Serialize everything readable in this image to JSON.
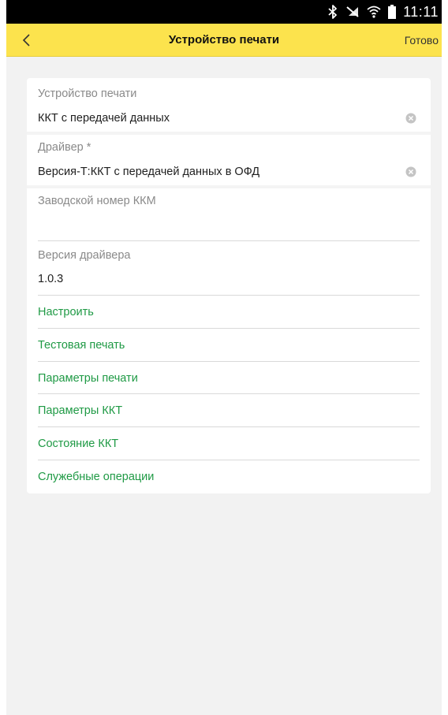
{
  "status_bar": {
    "time": "11:11",
    "icons": [
      "bluetooth-icon",
      "mute-icon",
      "wifi-icon",
      "battery-icon"
    ]
  },
  "nav_bar": {
    "back_icon": "chevron-left-icon",
    "title": "Устройство печати",
    "done_label": "Готово",
    "color": "#fce34d"
  },
  "form": {
    "device": {
      "label": "Устройство печати",
      "value": "ККТ с передачей данных"
    },
    "driver": {
      "label": "Драйвер *",
      "value": "Версия-Т:ККТ с передачей данных в ОФД"
    },
    "serial": {
      "label": "Заводской номер ККМ",
      "value": ""
    },
    "driver_version": {
      "label": "Версия драйвера",
      "value": "1.0.3"
    }
  },
  "actions": [
    {
      "label": "Настроить"
    },
    {
      "label": "Тестовая печать"
    },
    {
      "label": "Параметры печати"
    },
    {
      "label": "Параметры ККТ"
    },
    {
      "label": "Состояние ККТ"
    },
    {
      "label": "Служебные операции"
    }
  ],
  "colors": {
    "accent_green": "#1f9a45",
    "label_gray": "#8a8a8a",
    "background": "#f2f2f2"
  }
}
